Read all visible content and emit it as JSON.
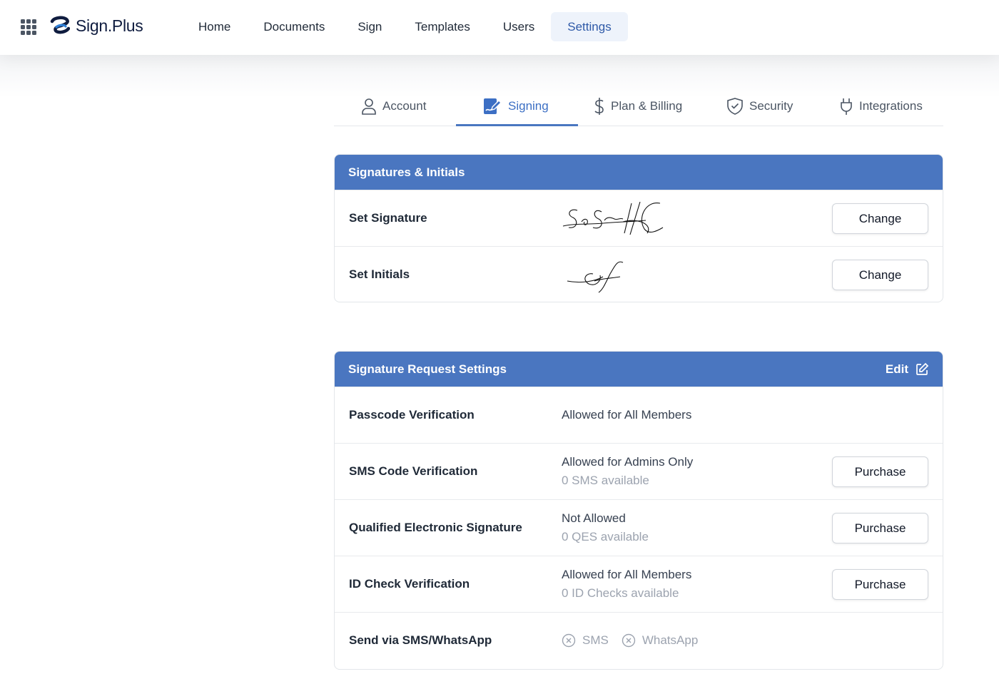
{
  "header": {
    "logo_text": "Sign.Plus",
    "nav": [
      "Home",
      "Documents",
      "Sign",
      "Templates",
      "Users",
      "Settings"
    ],
    "active_nav": "Settings"
  },
  "tabs": {
    "account": "Account",
    "signing": "Signing",
    "billing": "Plan & Billing",
    "security": "Security",
    "integrations": "Integrations",
    "active": "Signing"
  },
  "signatures": {
    "title": "Signatures & Initials",
    "set_signature_label": "Set Signature",
    "set_initials_label": "Set Initials",
    "change_label": "Change"
  },
  "request_settings": {
    "title": "Signature Request Settings",
    "edit_label": "Edit",
    "purchase_label": "Purchase",
    "rows": [
      {
        "label": "Passcode Verification",
        "value": "Allowed for All Members",
        "sub": ""
      },
      {
        "label": "SMS Code Verification",
        "value": "Allowed for Admins Only",
        "sub": "0 SMS available"
      },
      {
        "label": "Qualified Electronic Signature",
        "value": "Not Allowed",
        "sub": "0 QES available"
      },
      {
        "label": "ID Check Verification",
        "value": "Allowed for All Members",
        "sub": "0 ID Checks available"
      }
    ],
    "send_label": "Send via SMS/WhatsApp",
    "send_options": [
      "SMS",
      "WhatsApp"
    ]
  },
  "colors": {
    "accent": "#4a76c0",
    "active_nav_bg": "#eef3fb"
  }
}
